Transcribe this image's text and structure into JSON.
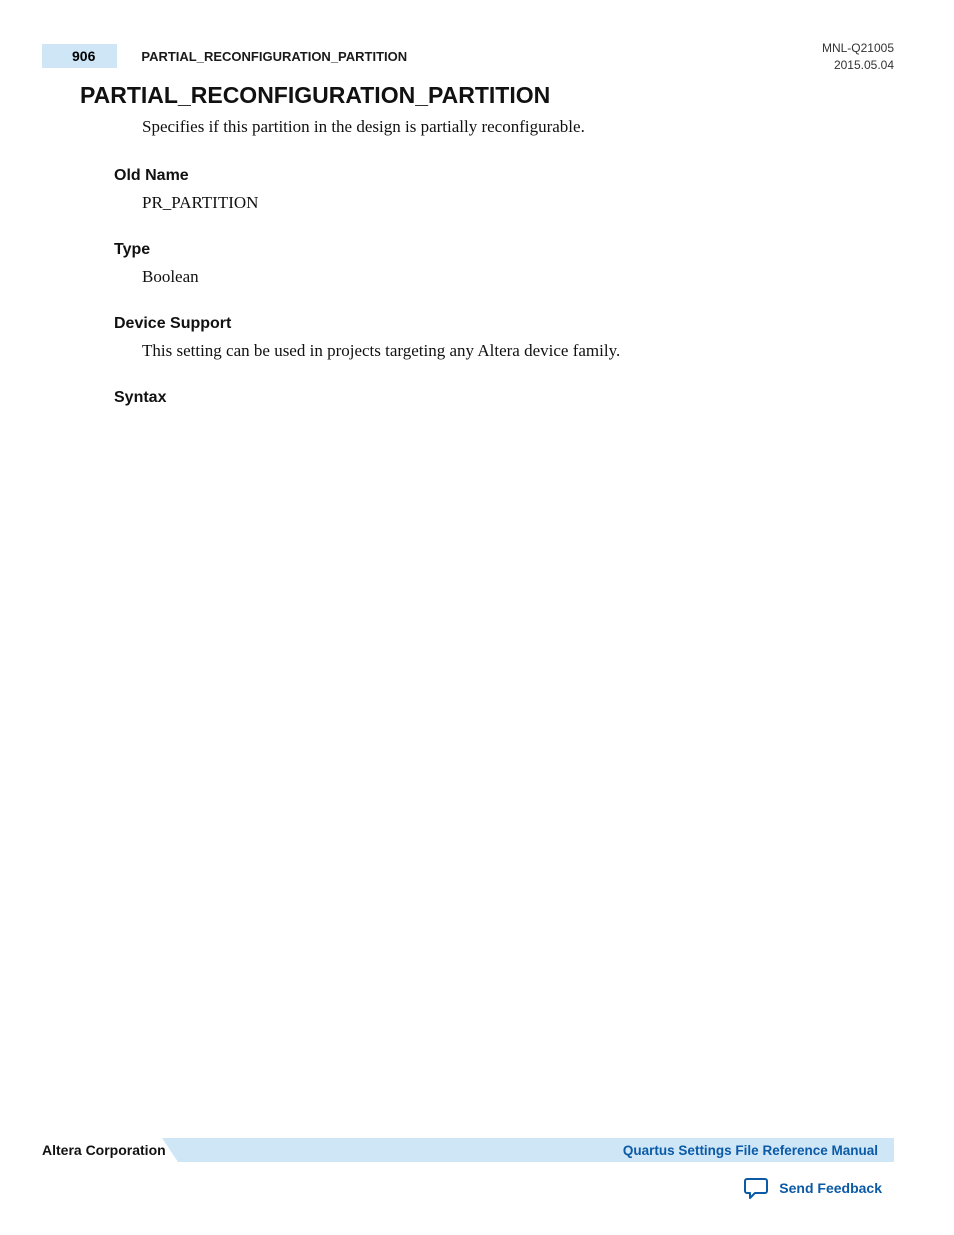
{
  "header": {
    "page_number": "906",
    "running_title": "PARTIAL_RECONFIGURATION_PARTITION",
    "doc_id": "MNL-Q21005",
    "doc_date": "2015.05.04"
  },
  "body": {
    "heading": "PARTIAL_RECONFIGURATION_PARTITION",
    "intro": "Specifies if this partition in the design is partially reconfigurable.",
    "sections": {
      "old_name_label": "Old Name",
      "old_name_value": "PR_PARTITION",
      "type_label": "Type",
      "type_value": "Boolean",
      "device_support_label": "Device Support",
      "device_support_value": "This setting can be used in projects targeting any Altera device family.",
      "syntax_label": "Syntax"
    }
  },
  "footer": {
    "company": "Altera Corporation",
    "manual_link": "Quartus Settings File Reference Manual",
    "feedback": "Send Feedback"
  }
}
